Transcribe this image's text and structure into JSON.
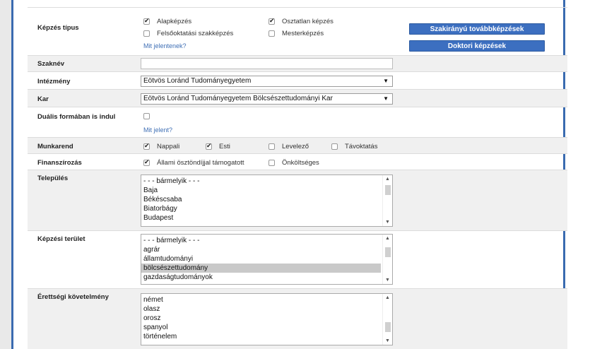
{
  "kepzes_tipus": {
    "label": "Képzés típus",
    "options": [
      {
        "label": "Alapképzés",
        "checked": true
      },
      {
        "label": "Osztatlan képzés",
        "checked": true
      },
      {
        "label": "Felsőoktatási szakképzés",
        "checked": false
      },
      {
        "label": "Mesterképzés",
        "checked": false
      }
    ],
    "help_link": "Mit jelentenek?",
    "buttons": [
      "Szakirányú továbbképzések",
      "Doktori képzések"
    ]
  },
  "szaknev": {
    "label": "Szaknév",
    "value": ""
  },
  "intezmeny": {
    "label": "Intézmény",
    "value": "Eötvös Loránd Tudományegyetem"
  },
  "kar": {
    "label": "Kar",
    "value": "Eötvös Loránd Tudományegyetem Bölcsészettudományi Kar"
  },
  "dualis": {
    "label": "Duális formában is indul",
    "checked": false,
    "help_link": "Mit jelent?"
  },
  "munkarend": {
    "label": "Munkarend",
    "options": [
      {
        "label": "Nappali",
        "checked": true
      },
      {
        "label": "Esti",
        "checked": true
      },
      {
        "label": "Levelező",
        "checked": false
      },
      {
        "label": "Távoktatás",
        "checked": false
      }
    ]
  },
  "finanszirozas": {
    "label": "Finanszírozás",
    "options": [
      {
        "label": "Állami ösztöndíjjal támogatott",
        "checked": true
      },
      {
        "label": "Önköltséges",
        "checked": false
      }
    ]
  },
  "telepules": {
    "label": "Település",
    "items": [
      "- - - bármelyik - - -",
      "Baja",
      "Békéscsaba",
      "Biatorbágy",
      "Budapest"
    ],
    "selected_index": -1
  },
  "kepzesi_terulet": {
    "label": "Képzési terület",
    "items": [
      "- - - bármelyik - - -",
      "agrár",
      "államtudományi",
      "bölcsészettudomány",
      "gazdaságtudományok"
    ],
    "selected_index": 3
  },
  "erettsegi": {
    "label": "Érettségi követelmény",
    "items": [
      "német",
      "olasz",
      "orosz",
      "spanyol",
      "történelem"
    ],
    "selected_index": -1
  }
}
